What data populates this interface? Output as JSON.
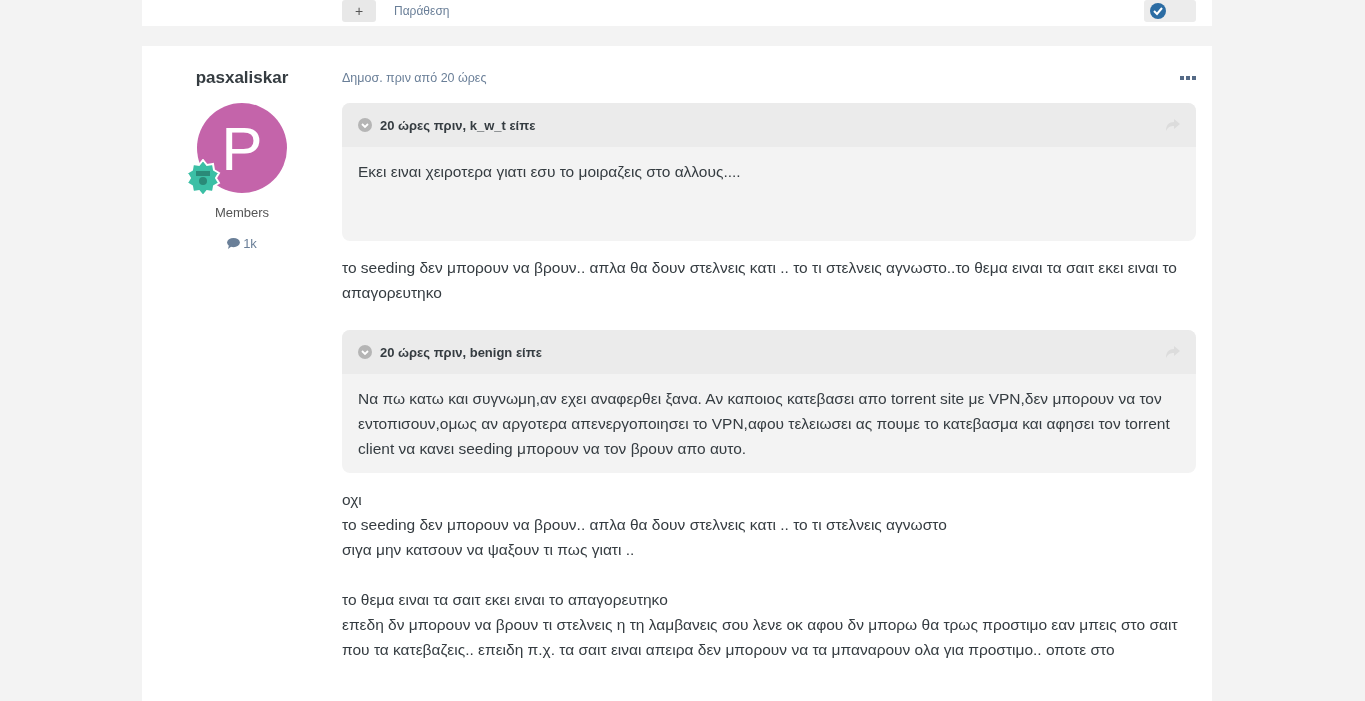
{
  "previous_post": {
    "quote_button": "+",
    "quote_label": "Παράθεση"
  },
  "post": {
    "author": "pasxaliskar",
    "avatar_letter": "P",
    "group": "Members",
    "post_count": "1k",
    "timestamp": "Δημοσ. πριν από 20 ώρες",
    "blocks": [
      {
        "kind": "quote",
        "citation": "20 ώρες πριν, k_w_t είπε",
        "lines": [
          "Εκει ειναι χειροτερα γιατι εσυ το μοιραζεις στο αλλους...."
        ]
      },
      {
        "kind": "text",
        "lines": [
          "το seeding δεν μπορουν να βρουν.. απλα θα δουν στελνεις κατι .. το τι στελνεις αγνωστο..το θεμα ειναι τα σαιτ εκει ειναι το απαγορευτηκο"
        ]
      },
      {
        "kind": "quote",
        "citation": "20 ώρες πριν, benign είπε",
        "lines": [
          "Να πω κατω και συγνωμη,αν εχει αναφερθει ξανα. Αν καποιος κατεβασει απο torrent site με VPN,δεν μπορουν να τον εντοπισουν,ομως αν αργοτερα απενεργοποιησει το VPN,αφου τελειωσει ας πουμε το κατεβασμα και αφησει τον torrent client να κανει seeding μπορουν να τον βρουν απο αυτο."
        ]
      },
      {
        "kind": "text",
        "lines": [
          "οχι",
          "το seeding δεν μπορουν να βρουν.. απλα θα δουν στελνεις κατι .. το τι στελνεις αγνωστο",
          "σιγα μην κατσουν να ψαξουν τι πως γιατι .."
        ]
      },
      {
        "kind": "text",
        "lines": [
          "το θεμα ειναι τα σαιτ εκει ειναι το απαγορευτηκο",
          "επεδη δν μπορουν να βρουν τι στελνεις η τη λαμβανεις σου λενε οκ αφου δν μπορω θα τρως προστιμο εαν μπεις στο σαιτ που τα κατεβαζεις.. επειδη π.χ. τα σαιτ ειναι απειρα δεν μπορουν να τα μπαναρουν ολα για προστιμο.. οποτε στο"
        ]
      }
    ]
  }
}
